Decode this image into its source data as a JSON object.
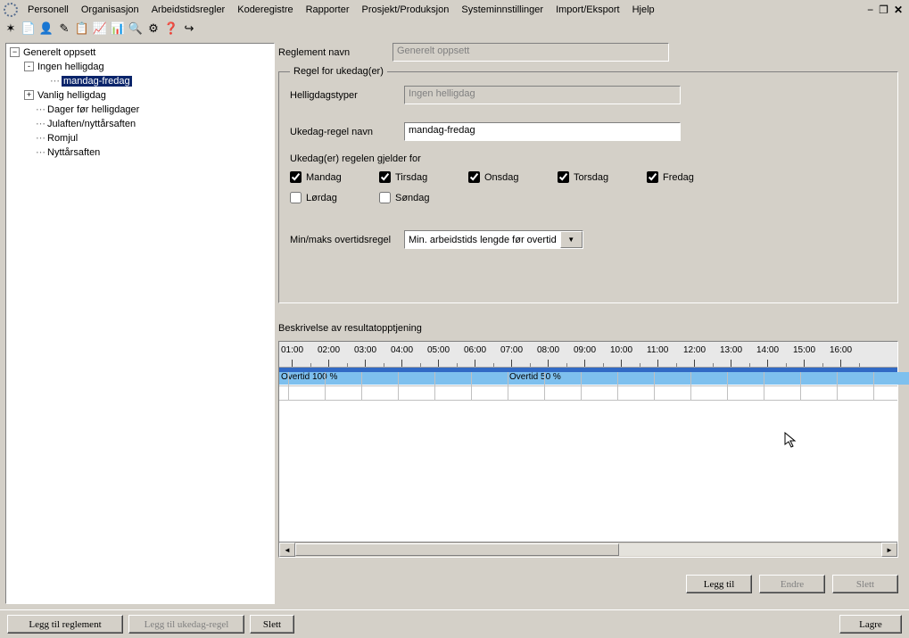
{
  "menu": {
    "items": [
      "Personell",
      "Organisasjon",
      "Arbeidstidsregler",
      "Koderegistre",
      "Rapporter",
      "Prosjekt/Produksjon",
      "Systeminnstillinger",
      "Import/Eksport",
      "Hjelp"
    ]
  },
  "toolbar_icons": [
    "✶",
    "📄",
    "👤",
    "✎",
    "📋",
    "📈",
    "📊",
    "🔍",
    "⚙",
    "❓",
    "↪"
  ],
  "tree": {
    "root": "Generelt oppsett",
    "items": [
      {
        "label": "Ingen helligdag",
        "expand": "-",
        "children": [
          {
            "label": "mandag-fredag",
            "selected": true,
            "expand": ""
          }
        ]
      },
      {
        "label": "Vanlig helligdag",
        "expand": "+"
      },
      {
        "label": "Dager før helligdager",
        "expand": ""
      },
      {
        "label": "Julaften/nyttårsaften",
        "expand": ""
      },
      {
        "label": "Romjul",
        "expand": ""
      },
      {
        "label": "Nyttårsaften",
        "expand": ""
      }
    ]
  },
  "form": {
    "reglement_navn_label": "Reglement navn",
    "reglement_navn_value": "Generelt oppsett",
    "fieldset_legend": "Regel for ukedag(er)",
    "helligdag_label": "Helligdagstyper",
    "helligdag_value": "Ingen helligdag",
    "ukedag_navn_label": "Ukedag-regel navn",
    "ukedag_navn_value": "mandag-fredag",
    "ukedag_gjelder_label": "Ukedag(er) regelen gjelder for",
    "days": [
      {
        "label": "Mandag",
        "checked": true
      },
      {
        "label": "Tirsdag",
        "checked": true
      },
      {
        "label": "Onsdag",
        "checked": true
      },
      {
        "label": "Torsdag",
        "checked": true
      },
      {
        "label": "Fredag",
        "checked": true
      },
      {
        "label": "Lørdag",
        "checked": false
      },
      {
        "label": "Søndag",
        "checked": false
      }
    ],
    "minmaks_label": "Min/maks overtidsregel",
    "minmaks_value": "Min. arbeidstids lengde før overtid",
    "beskrivelse_label": "Beskrivelse av resultatopptjening"
  },
  "timeline": {
    "hours": [
      "01:00",
      "02:00",
      "03:00",
      "04:00",
      "05:00",
      "06:00",
      "07:00",
      "08:00",
      "09:00",
      "10:00",
      "11:00",
      "12:00",
      "13:00",
      "14:00",
      "15:00",
      "16:00"
    ],
    "segments": [
      {
        "label": "Overtid 100 %",
        "start": 0,
        "end": 6
      },
      {
        "label": "Overtid 50 %",
        "start": 6,
        "end": 17
      }
    ]
  },
  "buttons": {
    "legg_til": "Legg til",
    "endre": "Endre",
    "slett": "Slett",
    "legg_til_reglement": "Legg til reglement",
    "legg_til_ukedag": "Legg til ukedag-regel",
    "lagre": "Lagre"
  }
}
